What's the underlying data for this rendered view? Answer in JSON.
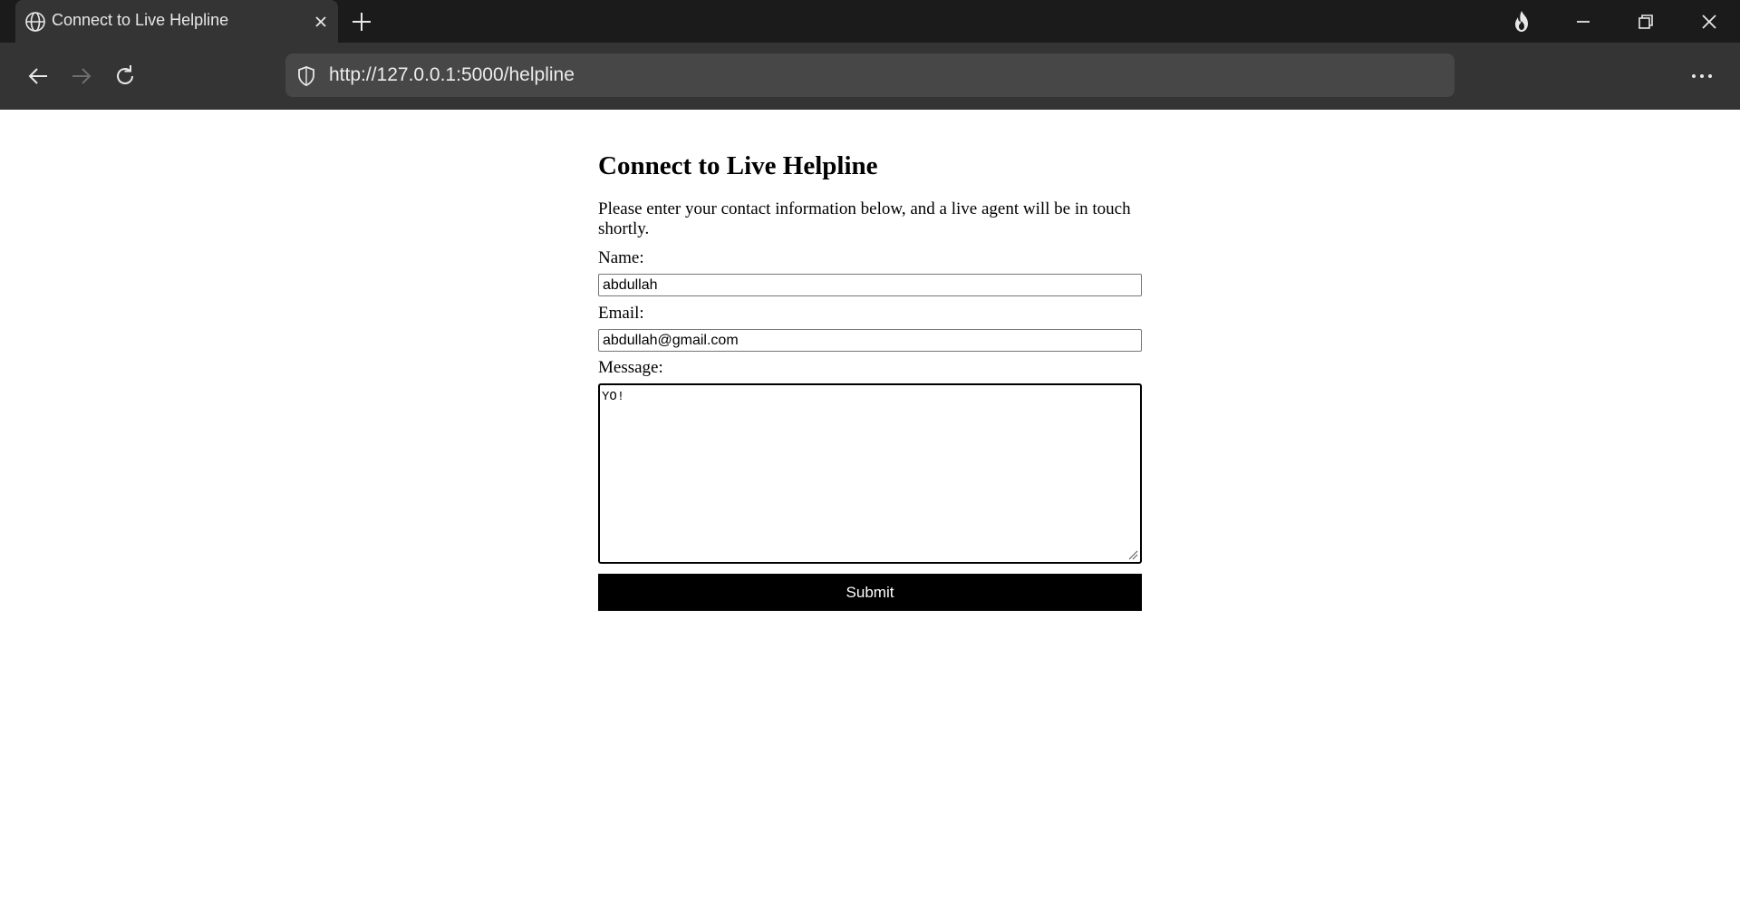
{
  "browser": {
    "tab": {
      "title": "Connect to Live Helpline"
    },
    "address_bar": {
      "url": "http://127.0.0.1:5000/helpline"
    },
    "icons": {
      "tab": "globe-icon",
      "close_tab": "close-icon",
      "new_tab": "plus-icon",
      "private": "flame-icon",
      "minimize": "minimize-icon",
      "restore": "restore-icon",
      "close_window": "close-icon",
      "back": "back-arrow-icon",
      "forward": "forward-arrow-icon",
      "reload": "reload-icon",
      "site_info": "shield-icon",
      "menu": "more-horizontal-icon"
    },
    "colors": {
      "titlebar": "#1b1b1b",
      "toolbar": "#343434",
      "address_bar": "#474747"
    }
  },
  "page": {
    "title": "Connect to Live Helpline",
    "intro": "Please enter your contact information below, and a live agent will be in touch shortly.",
    "form": {
      "name_label": "Name:",
      "name_value": "abdullah",
      "email_label": "Email:",
      "email_value": "abdullah@gmail.com",
      "message_label": "Message:",
      "message_value": "YO!",
      "submit_label": "Submit"
    }
  }
}
